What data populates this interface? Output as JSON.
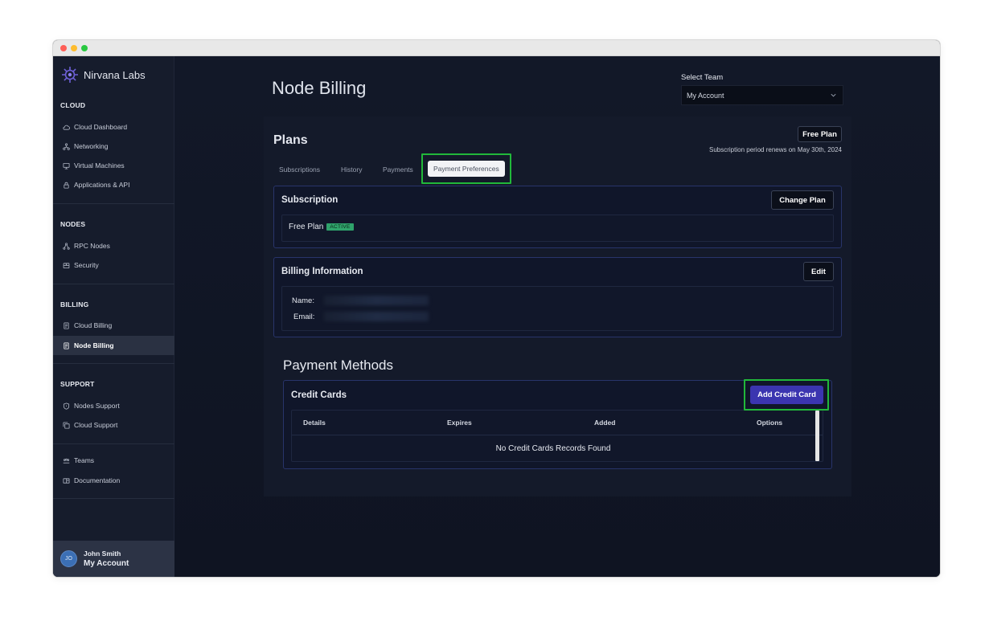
{
  "app": {
    "name": "Nirvana Labs"
  },
  "sidebar": {
    "sections": [
      {
        "title": "CLOUD",
        "items": [
          {
            "label": "Cloud Dashboard",
            "icon": "cloud-icon"
          },
          {
            "label": "Networking",
            "icon": "network-icon"
          },
          {
            "label": "Virtual Machines",
            "icon": "monitor-icon"
          },
          {
            "label": "Applications & API",
            "icon": "lock-icon"
          }
        ]
      },
      {
        "title": "NODES",
        "items": [
          {
            "label": "RPC Nodes",
            "icon": "nodes-icon"
          },
          {
            "label": "Security",
            "icon": "safe-icon"
          }
        ]
      },
      {
        "title": "BILLING",
        "items": [
          {
            "label": "Cloud Billing",
            "icon": "receipt-icon"
          },
          {
            "label": "Node Billing",
            "icon": "receipt-icon",
            "active": true
          }
        ]
      },
      {
        "title": "SUPPORT",
        "items": [
          {
            "label": "Nodes Support",
            "icon": "support-icon"
          },
          {
            "label": "Cloud Support",
            "icon": "copy-icon"
          }
        ]
      }
    ],
    "extra_items": [
      {
        "label": "Teams",
        "icon": "team-icon"
      },
      {
        "label": "Documentation",
        "icon": "book-icon"
      }
    ],
    "user": {
      "initials": "JO",
      "name": "John Smith",
      "account": "My Account"
    }
  },
  "header": {
    "title": "Node Billing",
    "team_label": "Select Team",
    "team_value": "My Account"
  },
  "plans": {
    "title": "Plans",
    "plan_badge": "Free Plan",
    "renew_text": "Subscription period renews on May 30th, 2024",
    "tabs": [
      "Subscriptions",
      "History",
      "Payments",
      "Payment Preferences"
    ],
    "active_tab": "Payment Preferences"
  },
  "subscription": {
    "title": "Subscription",
    "change_button": "Change Plan",
    "plan_name": "Free Plan",
    "status": "ACTIVE"
  },
  "billing_info": {
    "title": "Billing Information",
    "edit_button": "Edit",
    "name_label": "Name:",
    "email_label": "Email:"
  },
  "payment_methods": {
    "title": "Payment Methods",
    "credit_cards_title": "Credit Cards",
    "add_button": "Add Credit Card",
    "columns": [
      "Details",
      "Expires",
      "Added",
      "Options"
    ],
    "empty_text": "No Credit Cards Records Found"
  },
  "colors": {
    "highlight": "#21b83a",
    "primary_button": "#3b35b0",
    "active_badge": "#2fa36b",
    "card_border": "#28346a"
  }
}
